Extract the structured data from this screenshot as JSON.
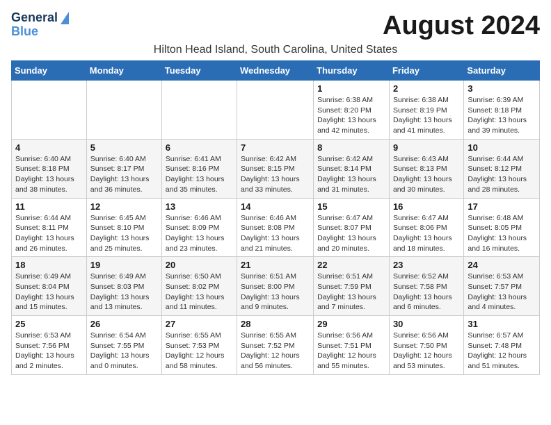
{
  "header": {
    "logo_line1": "General",
    "logo_line2": "Blue",
    "month_year": "August 2024",
    "location": "Hilton Head Island, South Carolina, United States"
  },
  "weekdays": [
    "Sunday",
    "Monday",
    "Tuesday",
    "Wednesday",
    "Thursday",
    "Friday",
    "Saturday"
  ],
  "weeks": [
    [
      {
        "day": "",
        "info": ""
      },
      {
        "day": "",
        "info": ""
      },
      {
        "day": "",
        "info": ""
      },
      {
        "day": "",
        "info": ""
      },
      {
        "day": "1",
        "info": "Sunrise: 6:38 AM\nSunset: 8:20 PM\nDaylight: 13 hours\nand 42 minutes."
      },
      {
        "day": "2",
        "info": "Sunrise: 6:38 AM\nSunset: 8:19 PM\nDaylight: 13 hours\nand 41 minutes."
      },
      {
        "day": "3",
        "info": "Sunrise: 6:39 AM\nSunset: 8:18 PM\nDaylight: 13 hours\nand 39 minutes."
      }
    ],
    [
      {
        "day": "4",
        "info": "Sunrise: 6:40 AM\nSunset: 8:18 PM\nDaylight: 13 hours\nand 38 minutes."
      },
      {
        "day": "5",
        "info": "Sunrise: 6:40 AM\nSunset: 8:17 PM\nDaylight: 13 hours\nand 36 minutes."
      },
      {
        "day": "6",
        "info": "Sunrise: 6:41 AM\nSunset: 8:16 PM\nDaylight: 13 hours\nand 35 minutes."
      },
      {
        "day": "7",
        "info": "Sunrise: 6:42 AM\nSunset: 8:15 PM\nDaylight: 13 hours\nand 33 minutes."
      },
      {
        "day": "8",
        "info": "Sunrise: 6:42 AM\nSunset: 8:14 PM\nDaylight: 13 hours\nand 31 minutes."
      },
      {
        "day": "9",
        "info": "Sunrise: 6:43 AM\nSunset: 8:13 PM\nDaylight: 13 hours\nand 30 minutes."
      },
      {
        "day": "10",
        "info": "Sunrise: 6:44 AM\nSunset: 8:12 PM\nDaylight: 13 hours\nand 28 minutes."
      }
    ],
    [
      {
        "day": "11",
        "info": "Sunrise: 6:44 AM\nSunset: 8:11 PM\nDaylight: 13 hours\nand 26 minutes."
      },
      {
        "day": "12",
        "info": "Sunrise: 6:45 AM\nSunset: 8:10 PM\nDaylight: 13 hours\nand 25 minutes."
      },
      {
        "day": "13",
        "info": "Sunrise: 6:46 AM\nSunset: 8:09 PM\nDaylight: 13 hours\nand 23 minutes."
      },
      {
        "day": "14",
        "info": "Sunrise: 6:46 AM\nSunset: 8:08 PM\nDaylight: 13 hours\nand 21 minutes."
      },
      {
        "day": "15",
        "info": "Sunrise: 6:47 AM\nSunset: 8:07 PM\nDaylight: 13 hours\nand 20 minutes."
      },
      {
        "day": "16",
        "info": "Sunrise: 6:47 AM\nSunset: 8:06 PM\nDaylight: 13 hours\nand 18 minutes."
      },
      {
        "day": "17",
        "info": "Sunrise: 6:48 AM\nSunset: 8:05 PM\nDaylight: 13 hours\nand 16 minutes."
      }
    ],
    [
      {
        "day": "18",
        "info": "Sunrise: 6:49 AM\nSunset: 8:04 PM\nDaylight: 13 hours\nand 15 minutes."
      },
      {
        "day": "19",
        "info": "Sunrise: 6:49 AM\nSunset: 8:03 PM\nDaylight: 13 hours\nand 13 minutes."
      },
      {
        "day": "20",
        "info": "Sunrise: 6:50 AM\nSunset: 8:02 PM\nDaylight: 13 hours\nand 11 minutes."
      },
      {
        "day": "21",
        "info": "Sunrise: 6:51 AM\nSunset: 8:00 PM\nDaylight: 13 hours\nand 9 minutes."
      },
      {
        "day": "22",
        "info": "Sunrise: 6:51 AM\nSunset: 7:59 PM\nDaylight: 13 hours\nand 7 minutes."
      },
      {
        "day": "23",
        "info": "Sunrise: 6:52 AM\nSunset: 7:58 PM\nDaylight: 13 hours\nand 6 minutes."
      },
      {
        "day": "24",
        "info": "Sunrise: 6:53 AM\nSunset: 7:57 PM\nDaylight: 13 hours\nand 4 minutes."
      }
    ],
    [
      {
        "day": "25",
        "info": "Sunrise: 6:53 AM\nSunset: 7:56 PM\nDaylight: 13 hours\nand 2 minutes."
      },
      {
        "day": "26",
        "info": "Sunrise: 6:54 AM\nSunset: 7:55 PM\nDaylight: 13 hours\nand 0 minutes."
      },
      {
        "day": "27",
        "info": "Sunrise: 6:55 AM\nSunset: 7:53 PM\nDaylight: 12 hours\nand 58 minutes."
      },
      {
        "day": "28",
        "info": "Sunrise: 6:55 AM\nSunset: 7:52 PM\nDaylight: 12 hours\nand 56 minutes."
      },
      {
        "day": "29",
        "info": "Sunrise: 6:56 AM\nSunset: 7:51 PM\nDaylight: 12 hours\nand 55 minutes."
      },
      {
        "day": "30",
        "info": "Sunrise: 6:56 AM\nSunset: 7:50 PM\nDaylight: 12 hours\nand 53 minutes."
      },
      {
        "day": "31",
        "info": "Sunrise: 6:57 AM\nSunset: 7:48 PM\nDaylight: 12 hours\nand 51 minutes."
      }
    ]
  ]
}
